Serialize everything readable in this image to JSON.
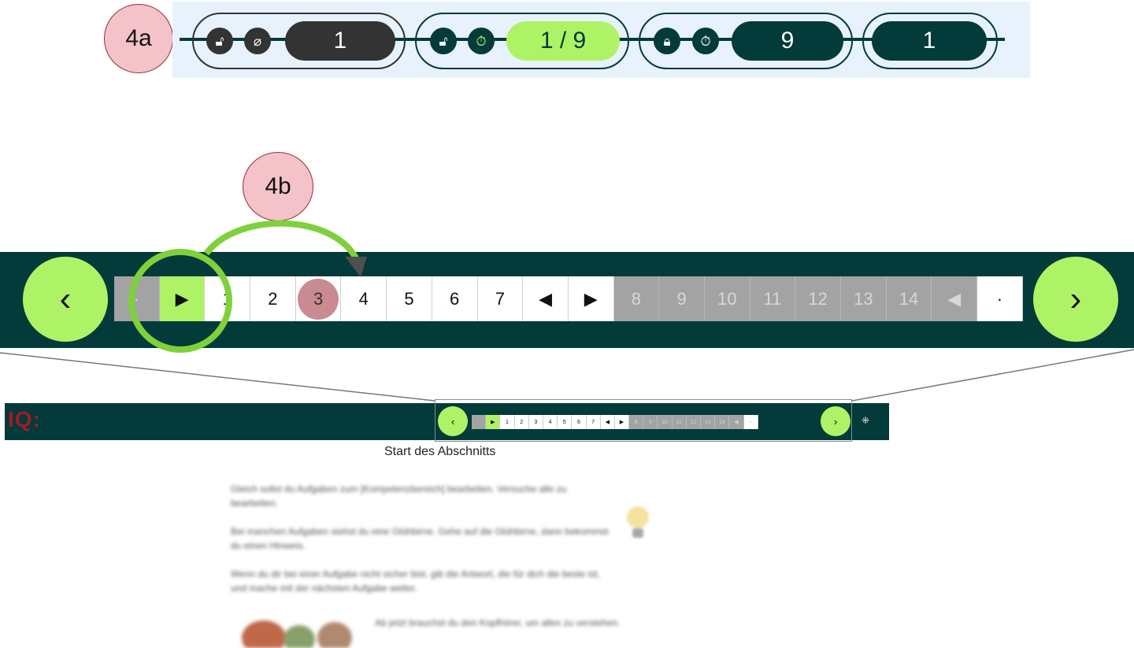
{
  "callouts": {
    "a": "4a",
    "b": "4b"
  },
  "status_bar": {
    "groups": [
      {
        "icons": [
          "unlocked-icon",
          "timer-off-icon"
        ],
        "value": "1"
      },
      {
        "icons": [
          "unlocked-icon",
          "timer-icon"
        ],
        "value": "1 / 9"
      },
      {
        "icons": [
          "locked-icon",
          "timer-icon"
        ],
        "value": "9"
      },
      {
        "icons": [],
        "value": "1"
      }
    ],
    "colors": {
      "dark": "#333333",
      "teal": "#033a3a",
      "accent": "#aef366"
    }
  },
  "unit_nav": {
    "prev_label": "‹",
    "next_label": "›",
    "items": [
      {
        "label": "·",
        "state": "disabled"
      },
      {
        "label": "▶",
        "state": "highlighted"
      },
      {
        "label": "1",
        "state": "normal"
      },
      {
        "label": "2",
        "state": "normal"
      },
      {
        "label": "3",
        "state": "current"
      },
      {
        "label": "4",
        "state": "normal"
      },
      {
        "label": "5",
        "state": "normal"
      },
      {
        "label": "6",
        "state": "normal"
      },
      {
        "label": "7",
        "state": "normal"
      },
      {
        "label": "◀",
        "state": "normal"
      },
      {
        "label": "▶",
        "state": "normal"
      },
      {
        "label": "8",
        "state": "disabled"
      },
      {
        "label": "9",
        "state": "disabled"
      },
      {
        "label": "10",
        "state": "disabled"
      },
      {
        "label": "11",
        "state": "disabled"
      },
      {
        "label": "12",
        "state": "disabled"
      },
      {
        "label": "13",
        "state": "disabled"
      },
      {
        "label": "14",
        "state": "disabled"
      },
      {
        "label": "◀",
        "state": "disabled"
      },
      {
        "label": "·",
        "state": "normal"
      }
    ]
  },
  "header": {
    "logo": "IQ:",
    "fullscreen_icon": "collapse-icon"
  },
  "page": {
    "title": "Start des Abschnitts",
    "paragraphs": [
      "Gleich sollst du Aufgaben zum [Kompetenzbereich] bearbeiten. Versuche alle zu bearbeiten.",
      "Bei manchen Aufgaben siehst du eine Glühbirne. Gehe auf die Glühbirne, dann bekommst du einen Hinweis.",
      "Wenn du dir bei einer Aufgabe nicht sicher bist, gib die Antwort, die für dich die beste ist, und mache mit der nächsten Aufgabe weiter.",
      "Ab jetzt brauchst du den Kopfhörer, um alles zu verstehen."
    ]
  }
}
